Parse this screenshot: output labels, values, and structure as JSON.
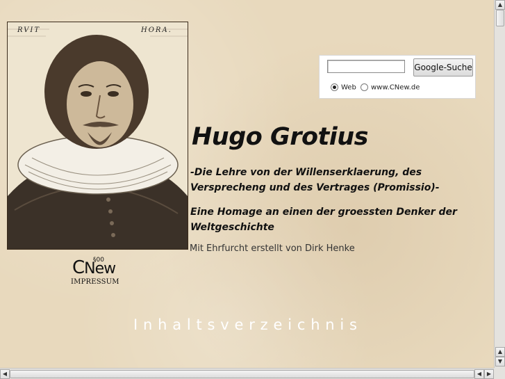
{
  "portrait": {
    "left_inscription": "RVIT",
    "right_inscription": "HORA."
  },
  "logo": {
    "mark": "New",
    "mark_prefix": "C",
    "superscript": "§00",
    "label": "IMPRESSUM"
  },
  "search": {
    "input_value": "",
    "button_label": "Google-Suche",
    "options": [
      {
        "label": "Web",
        "checked": true
      },
      {
        "label": "www.CNew.de",
        "checked": false
      }
    ]
  },
  "heading": {
    "title": "Hugo Grotius",
    "subtitle1": "-Die Lehre von der Willenserklaerung, des Versprecheng und des Vertrages (Promissio)-",
    "subtitle2": "Eine Homage an einen der groessten Denker der Weltgeschichte",
    "credit": "Mit Ehrfurcht erstellt von Dirk Henke"
  },
  "nav": {
    "toc_label": "Inhaltsverzeichnis"
  },
  "scrollbars": {
    "up_arrow": "▲",
    "down_arrow": "▼",
    "left_arrow": "◀",
    "right_arrow": "▶"
  }
}
